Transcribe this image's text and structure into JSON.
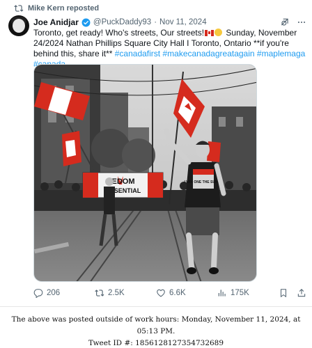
{
  "repost": {
    "label": "Mike Kern reposted"
  },
  "tweet": {
    "author_name": "Joe Anidjar",
    "handle": "@PuckDaddy93",
    "separator": "·",
    "date": "Nov 11, 2024",
    "text_part1": "Toronto, get ready! Who's streets, Our streets!",
    "text_part2": " Sunday, November 24/2024 Nathan Phillips Square City Hall I Toronto, Ontario **if you're behind this, share it** ",
    "hashtags": [
      "#canadafirst",
      "#makecanadagreatagain",
      "#maplemaga",
      "#canada"
    ],
    "media": {
      "banner_text_top": "EDOM",
      "banner_text_bottom": "ESSENTIAL",
      "shirt_text": "I WIN ONE THE SUNNY"
    }
  },
  "actions": {
    "replies": "206",
    "reposts": "2.5K",
    "likes": "6.6K",
    "views": "175K"
  },
  "footer": {
    "line1": "The above was posted outside of work hours: Monday, November 11, 2024, at 05:13 PM.",
    "line2": "Tweet ID #: 1856128127354732689"
  },
  "colors": {
    "accent": "#1d9bf0",
    "muted": "#536471",
    "flag_red": "#d52b1e"
  },
  "icons": [
    "repost-icon",
    "verified-badge-icon",
    "grok-icon",
    "more-icon",
    "reply-icon",
    "like-icon",
    "views-icon",
    "bookmark-icon",
    "share-icon"
  ]
}
